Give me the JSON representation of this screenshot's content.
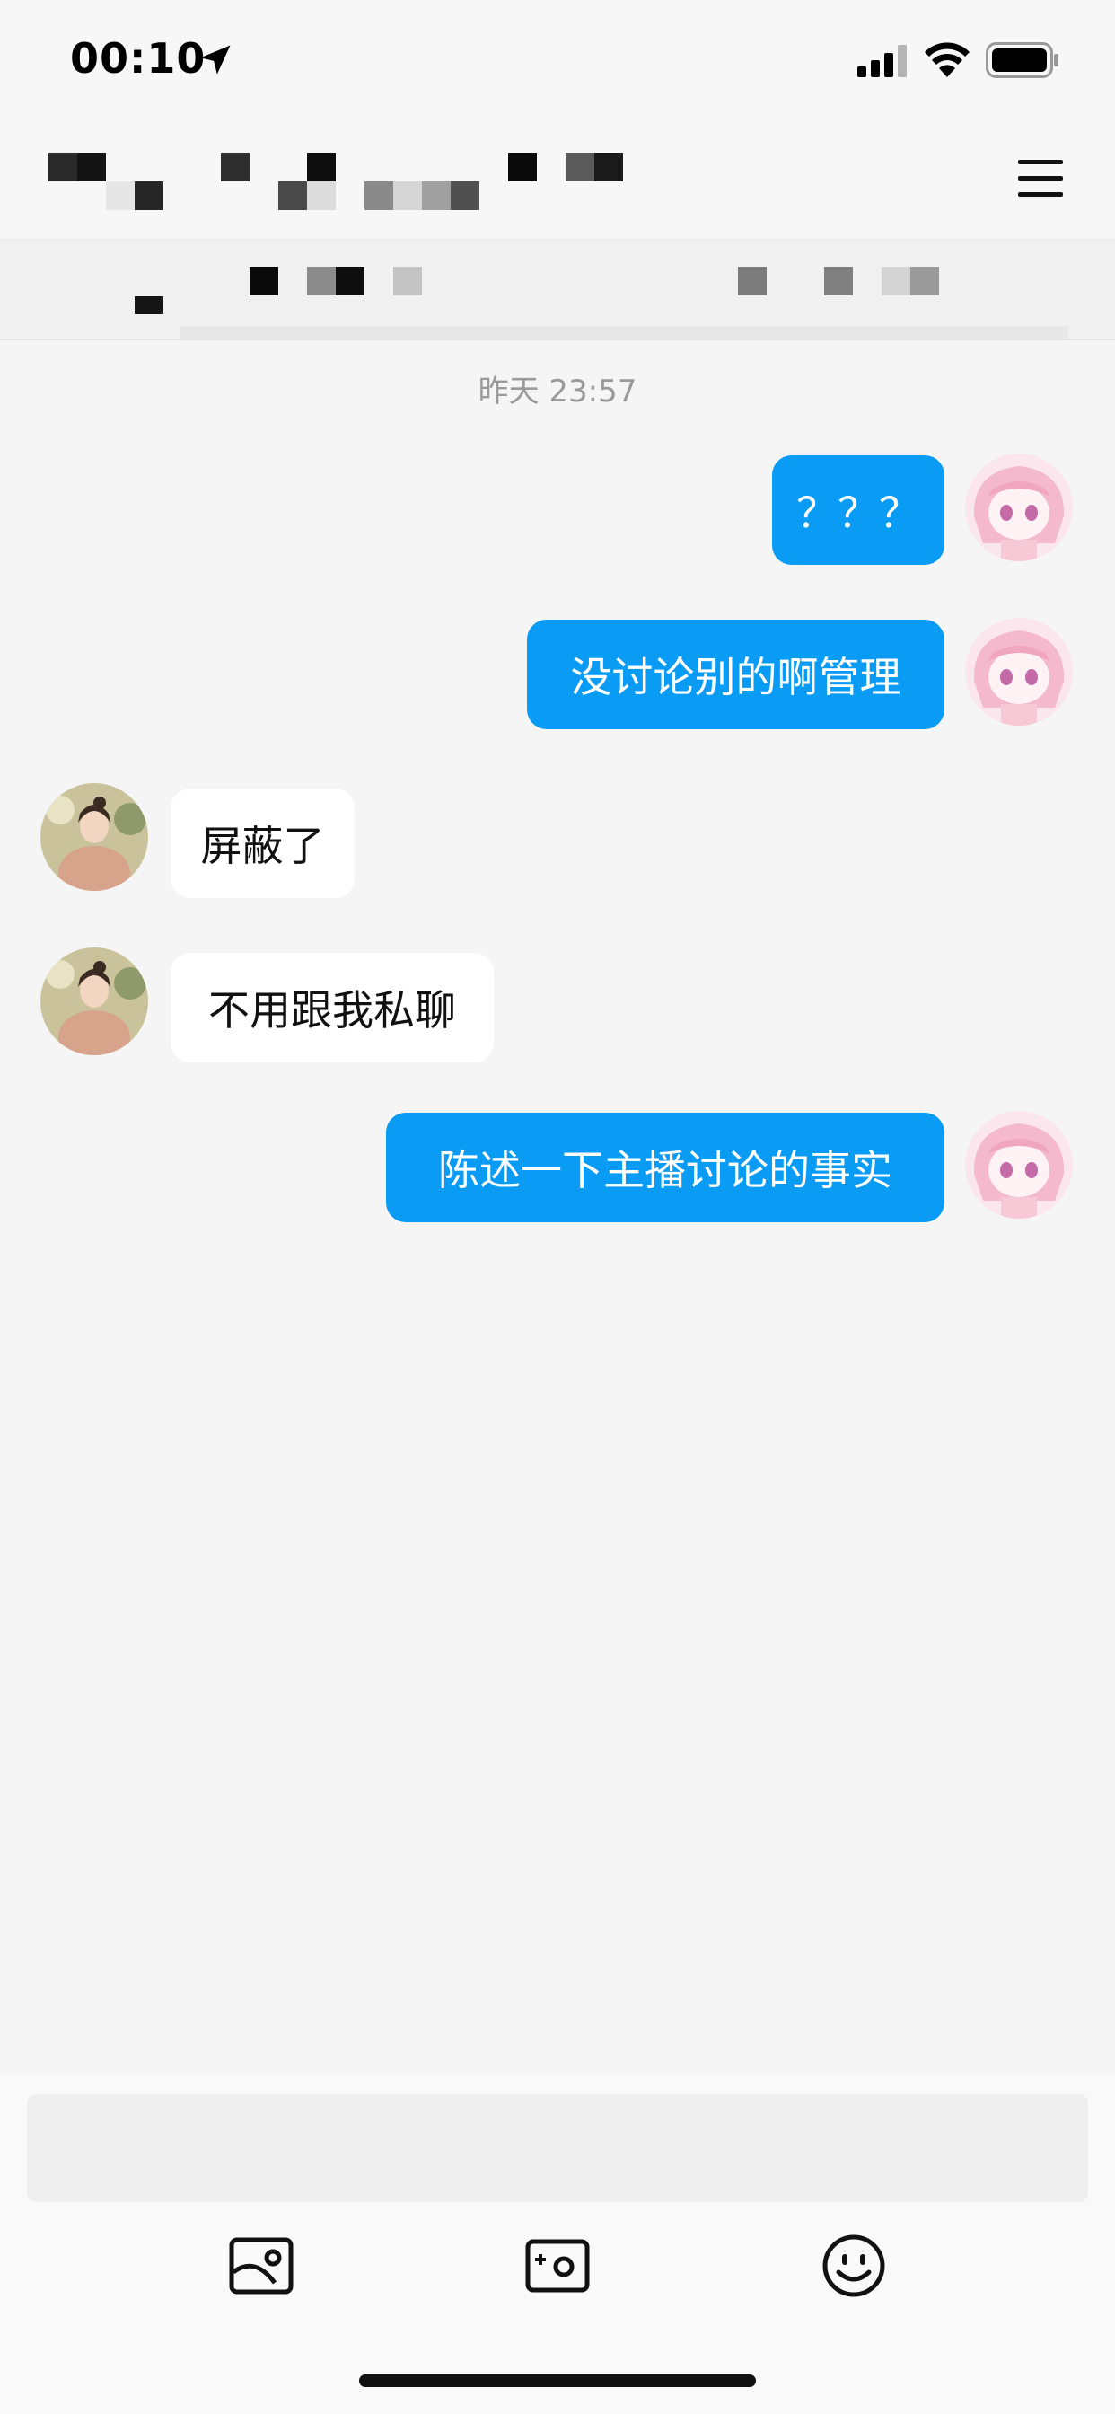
{
  "status_bar": {
    "time": "00:10"
  },
  "chat": {
    "timestamp": "昨天 23:57",
    "messages": [
      {
        "direction": "outgoing",
        "text": "？？？"
      },
      {
        "direction": "outgoing",
        "text": "没讨论别的啊管理"
      },
      {
        "direction": "incoming",
        "text": "屏蔽了"
      },
      {
        "direction": "incoming",
        "text": "不用跟我私聊"
      },
      {
        "direction": "outgoing",
        "text": "陈述一下主播讨论的事实"
      }
    ]
  },
  "input": {
    "placeholder": ""
  },
  "toolbar": {
    "icons": [
      "image-icon",
      "camera-icon",
      "emoji-icon"
    ]
  },
  "colors": {
    "outgoing_bubble": "#0a9bf5",
    "incoming_bubble": "#ffffff",
    "background": "#f5f5f5"
  }
}
